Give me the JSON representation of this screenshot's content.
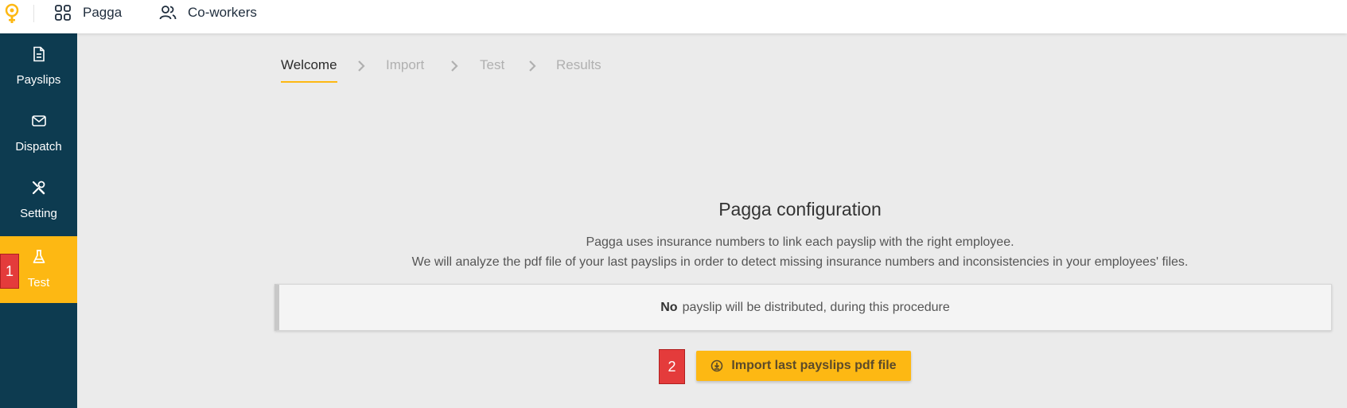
{
  "topbar": {
    "nav": [
      {
        "label": "Pagga",
        "icon": "grid-icon"
      },
      {
        "label": "Co-workers",
        "icon": "users-icon"
      }
    ]
  },
  "sidebar": {
    "items": [
      {
        "label": "Payslips",
        "icon": "document-icon",
        "active": false
      },
      {
        "label": "Dispatch",
        "icon": "mail-icon",
        "active": false
      },
      {
        "label": "Setting",
        "icon": "tools-icon",
        "active": false
      },
      {
        "label": "Test",
        "icon": "flask-icon",
        "active": true
      }
    ]
  },
  "stepper": {
    "steps": [
      {
        "label": "Welcome",
        "active": true
      },
      {
        "label": "Import",
        "active": false
      },
      {
        "label": "Test",
        "active": false
      },
      {
        "label": "Results",
        "active": false
      }
    ]
  },
  "main": {
    "title": "Pagga configuration",
    "description_line1": "Pagga uses insurance numbers to link each payslip with the right employee.",
    "description_line2": "We will analyze the pdf file of your last payslips in order to detect missing insurance numbers and inconsistencies in your employees' files.",
    "notice": {
      "emphasis": "No",
      "text": "payslip will be distributed, during this procedure"
    },
    "import_button": {
      "label": "Import last payslips pdf file",
      "icon": "download-icon"
    }
  },
  "annotations": [
    {
      "label": "1"
    },
    {
      "label": "2"
    }
  ],
  "colors": {
    "accent": "#fdb813",
    "sidebar_bg": "#0d3b50",
    "main_bg": "#ebebeb",
    "badge": "#e43b3b"
  }
}
